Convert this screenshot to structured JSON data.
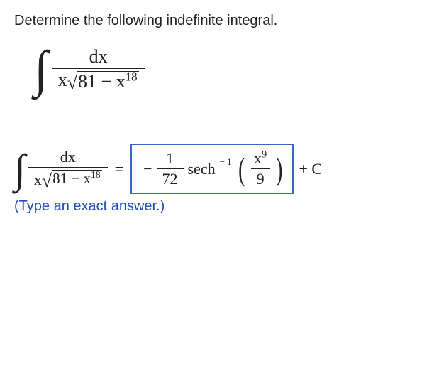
{
  "prompt": "Determine the following indefinite integral.",
  "integral": {
    "numerator": "dx",
    "den_lead": "x",
    "radicand_a": "81",
    "radicand_op": "−",
    "radicand_b": "x",
    "radicand_exp": "18"
  },
  "equals": "=",
  "answer": {
    "pre_minus": "−",
    "coef_num": "1",
    "coef_den": "72",
    "func": "sech",
    "inv_exp": "− 1",
    "arg_num_base": "x",
    "arg_num_exp": "9",
    "arg_den": "9"
  },
  "plusC": "+ C",
  "hint": "(Type an exact answer.)"
}
